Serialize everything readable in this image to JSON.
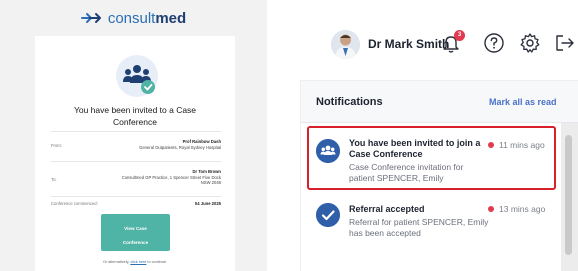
{
  "email": {
    "brand": {
      "prefix": "consult",
      "suffix": "med"
    },
    "title": "You have been invited to a Case Conference",
    "from_label": "From:",
    "from_name": "Prof Rainbow Dash",
    "from_org": "General Outpatients, Royal Sydney Hospital",
    "to_label": "To:",
    "to_name": "Dr Tom Brown",
    "to_org": "Consultmed GP Practice, 1 Spencer Street Five Dock NSW 2046",
    "commenced_label": "Conference commenced:",
    "commenced_date": "04 June 2025",
    "button_line1": "View Case",
    "button_line2": "Conference",
    "alt_prefix": "Or alternatively, ",
    "alt_link": "click here",
    "alt_suffix": " to continue."
  },
  "header": {
    "user_name": "Dr Mark Smith",
    "notification_count": "3",
    "icons": [
      "bell-icon",
      "help-icon",
      "gear-icon",
      "logout-icon"
    ]
  },
  "notifications": {
    "title": "Notifications",
    "mark_all": "Mark all as read",
    "items": [
      {
        "title": "You have been invited to join a Case Conference",
        "body": "Case Conference invitation for patient SPENCER, Emily",
        "time": "11 mins ago",
        "icon": "users-icon"
      },
      {
        "title": "Referral accepted",
        "body": "Referral for patient SPENCER, Emily has been accepted",
        "time": "13 mins ago",
        "icon": "check-icon"
      }
    ]
  },
  "colors": {
    "brand_teal": "#4fb3a5",
    "brand_blue": "#2b6fb6",
    "navy": "#1f3f73",
    "notif_icon": "#2f5fa8",
    "unread_dot": "#e23b4f",
    "highlight": "#d8202a"
  }
}
